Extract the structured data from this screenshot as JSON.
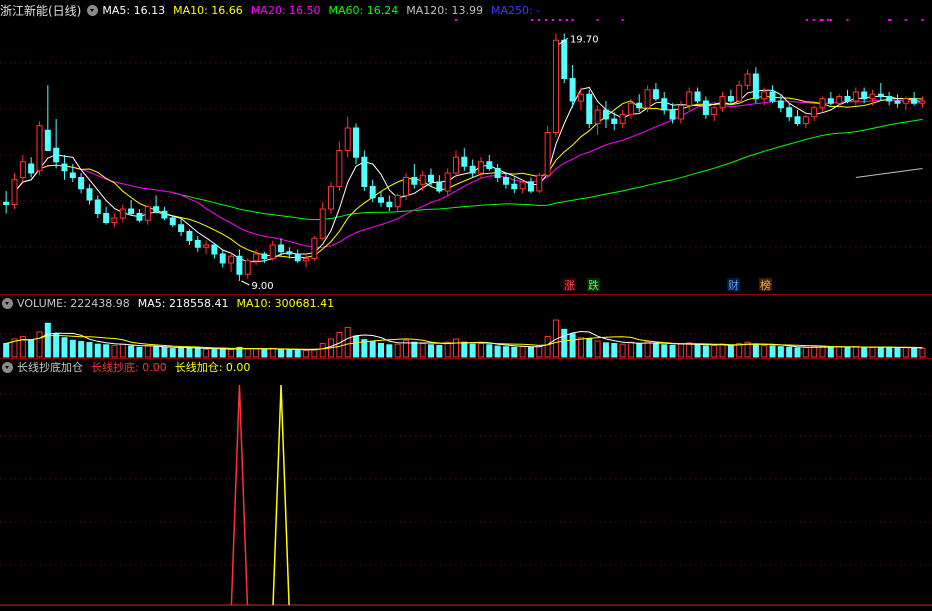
{
  "main_header": {
    "title": "浙江新能(日线)",
    "ma5": "MA5: 16.13",
    "ma10": "MA10: 16.66",
    "ma20": "MA20: 16.50",
    "ma60": "MA60: 16.24",
    "ma120": "MA120: 13.99",
    "ma250": "MA250: -"
  },
  "annotations": {
    "high_price": "19.70",
    "low_price": "9.00",
    "tag_zhang": "涨",
    "tag_die": "跌",
    "tag_cai": "财",
    "tag_bang": "榜"
  },
  "volume_header": {
    "label": "VOLUME: 222438.98",
    "ma5": "MA5: 218558.41",
    "ma10": "MA10: 300681.41"
  },
  "indicator_header": {
    "name": "长线抄底加仓",
    "chaodi": "长线抄底: 0.00",
    "jiacang": "长线加仓: 0.00"
  },
  "colors": {
    "up": "#ff3232",
    "down": "#54ffff",
    "ma5": "#ffffff",
    "ma10": "#ffff00",
    "ma20": "#ff00ff",
    "ma60": "#00ff00",
    "ma120": "#c0c0c0",
    "ma250": "#3c3cff",
    "grid": "#8b0000"
  },
  "chart_data": {
    "type": "candlestick",
    "price_ylim": [
      8.6,
      20.6
    ],
    "ohlc": [
      [
        12.5,
        13.0,
        12.0,
        12.4
      ],
      [
        12.4,
        13.8,
        12.2,
        13.5
      ],
      [
        13.6,
        14.6,
        13.4,
        14.3
      ],
      [
        14.2,
        14.5,
        13.6,
        13.8
      ],
      [
        13.9,
        16.1,
        13.7,
        15.9
      ],
      [
        15.7,
        17.7,
        15.0,
        14.8
      ],
      [
        14.9,
        16.2,
        14.0,
        14.3
      ],
      [
        14.2,
        14.6,
        13.5,
        13.9
      ],
      [
        13.8,
        14.2,
        13.4,
        13.6
      ],
      [
        13.6,
        13.8,
        12.9,
        13.1
      ],
      [
        13.1,
        13.3,
        12.4,
        12.6
      ],
      [
        12.6,
        12.8,
        11.8,
        12.0
      ],
      [
        12.0,
        12.3,
        11.5,
        11.6
      ],
      [
        11.6,
        12.0,
        11.4,
        11.8
      ],
      [
        11.8,
        12.4,
        11.6,
        12.2
      ],
      [
        12.2,
        12.6,
        11.9,
        12.0
      ],
      [
        12.0,
        12.2,
        11.6,
        11.7
      ],
      [
        11.7,
        12.4,
        11.5,
        12.3
      ],
      [
        12.3,
        12.8,
        12.0,
        12.1
      ],
      [
        12.1,
        12.3,
        11.7,
        11.8
      ],
      [
        11.8,
        11.9,
        11.4,
        11.5
      ],
      [
        11.5,
        11.8,
        11.0,
        11.2
      ],
      [
        11.2,
        11.3,
        10.6,
        10.8
      ],
      [
        10.8,
        11.0,
        10.3,
        10.5
      ],
      [
        10.5,
        10.8,
        10.2,
        10.6
      ],
      [
        10.6,
        10.7,
        10.0,
        10.2
      ],
      [
        10.2,
        10.4,
        9.6,
        9.8
      ],
      [
        9.8,
        10.3,
        9.4,
        10.1
      ],
      [
        10.1,
        10.4,
        9.0,
        9.3
      ],
      [
        9.3,
        10.0,
        9.1,
        9.9
      ],
      [
        9.9,
        10.4,
        9.7,
        10.2
      ],
      [
        10.2,
        10.3,
        9.8,
        10.0
      ],
      [
        10.0,
        10.8,
        9.9,
        10.6
      ],
      [
        10.6,
        10.9,
        10.1,
        10.3
      ],
      [
        10.3,
        10.5,
        10.0,
        10.2
      ],
      [
        10.2,
        10.4,
        9.8,
        9.9
      ],
      [
        9.9,
        10.2,
        9.6,
        10.0
      ],
      [
        10.0,
        11.0,
        9.9,
        10.9
      ],
      [
        10.9,
        12.5,
        10.8,
        12.2
      ],
      [
        12.2,
        13.4,
        12.0,
        13.2
      ],
      [
        13.2,
        15.2,
        13.0,
        14.8
      ],
      [
        14.8,
        16.3,
        14.5,
        15.8
      ],
      [
        15.8,
        16.0,
        14.2,
        14.5
      ],
      [
        14.5,
        14.8,
        13.0,
        13.2
      ],
      [
        13.2,
        13.5,
        12.5,
        12.7
      ],
      [
        12.7,
        13.0,
        12.3,
        12.5
      ],
      [
        12.5,
        12.8,
        12.1,
        12.3
      ],
      [
        12.3,
        12.9,
        12.1,
        12.8
      ],
      [
        12.8,
        13.8,
        12.6,
        13.6
      ],
      [
        13.6,
        14.2,
        13.1,
        13.3
      ],
      [
        13.3,
        13.9,
        13.0,
        13.7
      ],
      [
        13.7,
        14.0,
        13.2,
        13.4
      ],
      [
        13.4,
        13.7,
        12.9,
        13.0
      ],
      [
        13.0,
        14.0,
        12.8,
        13.8
      ],
      [
        13.8,
        14.8,
        13.6,
        14.5
      ],
      [
        14.5,
        14.9,
        13.9,
        14.1
      ],
      [
        14.1,
        14.4,
        13.6,
        13.8
      ],
      [
        13.8,
        14.5,
        13.6,
        14.3
      ],
      [
        14.3,
        14.6,
        13.9,
        14.0
      ],
      [
        14.0,
        14.2,
        13.4,
        13.6
      ],
      [
        13.6,
        13.8,
        13.1,
        13.3
      ],
      [
        13.3,
        13.6,
        12.9,
        13.1
      ],
      [
        13.1,
        13.5,
        12.9,
        13.4
      ],
      [
        13.4,
        13.6,
        12.9,
        13.0
      ],
      [
        13.0,
        13.8,
        12.9,
        13.7
      ],
      [
        13.7,
        15.9,
        13.6,
        15.6
      ],
      [
        15.6,
        20.0,
        15.4,
        19.7
      ],
      [
        19.7,
        20.0,
        17.8,
        18.0
      ],
      [
        18.0,
        18.6,
        16.7,
        17.0
      ],
      [
        17.0,
        17.6,
        16.6,
        17.3
      ],
      [
        17.3,
        17.5,
        15.8,
        16.0
      ],
      [
        16.0,
        16.8,
        15.5,
        16.6
      ],
      [
        16.6,
        17.0,
        15.8,
        16.2
      ],
      [
        16.2,
        16.5,
        15.7,
        16.0
      ],
      [
        16.0,
        16.6,
        15.8,
        16.4
      ],
      [
        16.4,
        17.1,
        16.2,
        16.9
      ],
      [
        16.9,
        17.3,
        16.5,
        16.7
      ],
      [
        16.7,
        17.7,
        16.5,
        17.5
      ],
      [
        17.5,
        17.8,
        17.0,
        17.1
      ],
      [
        17.1,
        17.4,
        16.4,
        16.6
      ],
      [
        16.6,
        16.9,
        16.0,
        16.2
      ],
      [
        16.2,
        17.0,
        16.0,
        16.8
      ],
      [
        16.8,
        17.6,
        16.6,
        17.4
      ],
      [
        17.4,
        17.6,
        16.9,
        17.0
      ],
      [
        17.0,
        17.2,
        16.2,
        16.4
      ],
      [
        16.4,
        16.8,
        16.1,
        16.7
      ],
      [
        16.7,
        17.4,
        16.5,
        17.2
      ],
      [
        17.2,
        17.5,
        16.8,
        17.0
      ],
      [
        17.0,
        17.9,
        16.9,
        17.7
      ],
      [
        17.7,
        18.4,
        17.5,
        18.2
      ],
      [
        18.2,
        18.5,
        16.9,
        17.1
      ],
      [
        17.1,
        17.6,
        16.8,
        17.4
      ],
      [
        17.4,
        17.7,
        16.9,
        17.0
      ],
      [
        17.0,
        17.3,
        16.5,
        16.7
      ],
      [
        16.7,
        16.9,
        16.1,
        16.3
      ],
      [
        16.3,
        16.6,
        15.9,
        16.0
      ],
      [
        16.0,
        16.4,
        15.8,
        16.3
      ],
      [
        16.3,
        16.8,
        16.1,
        16.7
      ],
      [
        16.7,
        17.2,
        16.5,
        17.1
      ],
      [
        17.1,
        17.4,
        16.8,
        16.9
      ],
      [
        16.9,
        17.3,
        16.7,
        17.2
      ],
      [
        17.2,
        17.5,
        16.9,
        17.0
      ],
      [
        17.0,
        17.6,
        16.8,
        17.4
      ],
      [
        17.4,
        17.6,
        16.9,
        17.1
      ],
      [
        17.1,
        17.5,
        16.8,
        17.3
      ],
      [
        17.3,
        17.8,
        17.0,
        17.2
      ],
      [
        17.2,
        17.4,
        16.8,
        17.0
      ],
      [
        17.0,
        17.3,
        16.7,
        16.9
      ],
      [
        16.9,
        17.2,
        16.6,
        17.1
      ],
      [
        17.1,
        17.4,
        16.8,
        16.9
      ],
      [
        16.9,
        17.2,
        16.7,
        17.0
      ]
    ],
    "volume_ylim": [
      0,
      1400000
    ],
    "volume": [
      420000,
      560000,
      640000,
      520000,
      780000,
      1050000,
      720000,
      600000,
      520000,
      480000,
      450000,
      400000,
      380000,
      360000,
      400000,
      340000,
      300000,
      340000,
      320000,
      300000,
      260000,
      280000,
      300000,
      260000,
      240000,
      230000,
      260000,
      240000,
      300000,
      260000,
      250000,
      230000,
      270000,
      230000,
      220000,
      210000,
      200000,
      240000,
      420000,
      560000,
      760000,
      920000,
      650000,
      540000,
      480000,
      420000,
      380000,
      400000,
      520000,
      460000,
      420000,
      380000,
      360000,
      460000,
      560000,
      460000,
      400000,
      420000,
      380000,
      340000,
      320000,
      300000,
      320000,
      300000,
      360000,
      640000,
      1150000,
      860000,
      720000,
      600000,
      560000,
      500000,
      440000,
      420000,
      400000,
      460000,
      420000,
      480000,
      420000,
      380000,
      360000,
      400000,
      440000,
      380000,
      340000,
      360000,
      400000,
      360000,
      420000,
      460000,
      400000,
      360000,
      340000,
      320000,
      300000,
      280000,
      300000,
      320000,
      340000,
      300000,
      320000,
      300000,
      320000,
      300000,
      300000,
      310000,
      290000,
      280000,
      290000,
      280000,
      270000
    ],
    "indicator_ylim": [
      0,
      1.0
    ],
    "indicator": {
      "chaodi": {
        "index": 28,
        "value": 1.0
      },
      "jiacang": {
        "index": 33,
        "value": 1.0
      }
    }
  }
}
